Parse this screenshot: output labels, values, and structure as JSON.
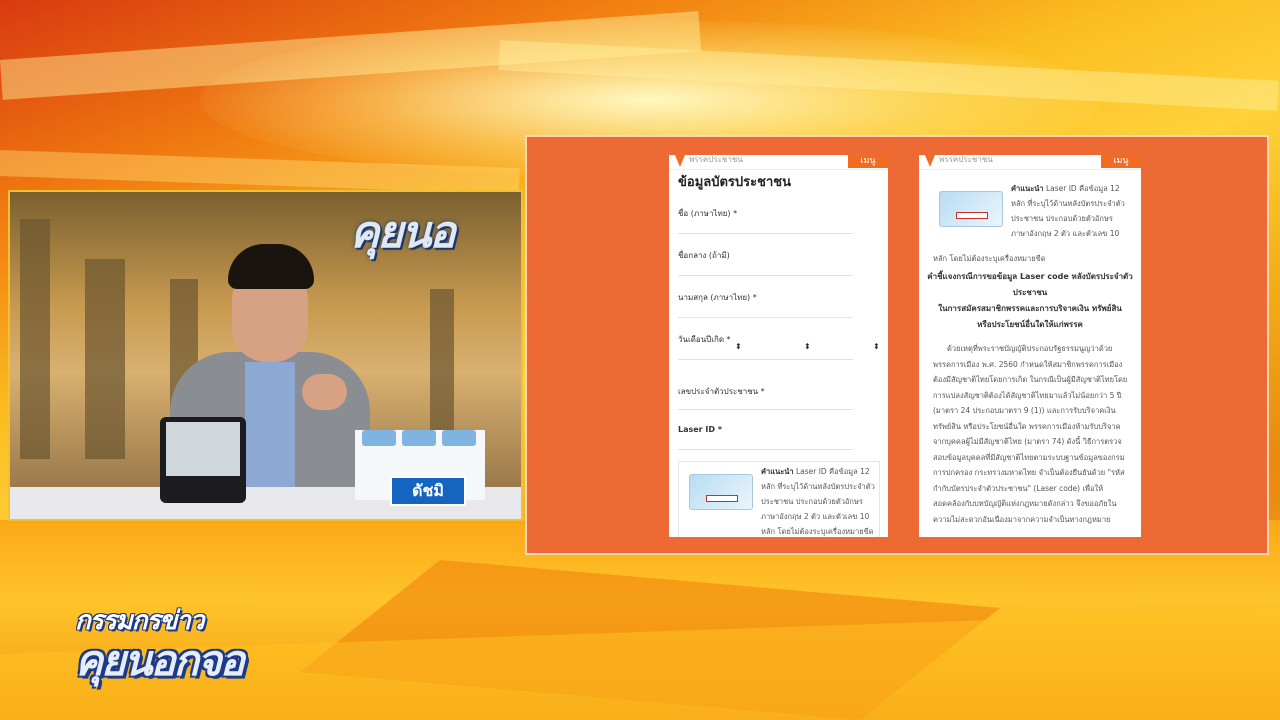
{
  "video": {
    "show_logo": "คุยนอ",
    "sponsor": "ดัชมิ"
  },
  "panel": {
    "left_phone": {
      "header_brand": "พรรคประชาชน",
      "menu_label": "เมนู",
      "form_title": "ข้อมูลบัตรประชาชน",
      "fields": [
        {
          "label": "ชื่อ (ภาษาไทย) *"
        },
        {
          "label": "ชื่อกลาง (ถ้ามี)"
        },
        {
          "label": "นามสกุล (ภาษาไทย) *"
        },
        {
          "label": "วันเดือนปีเกิด *"
        },
        {
          "label": "เลขประจำตัวประชาชน *"
        },
        {
          "label": "Laser ID *"
        }
      ],
      "tip_title": "คำแนะนำ",
      "tip_lines": [
        "Laser ID คือข้อมูล 12",
        "หลัก ที่ระบุไว้ด้านหลังบัตรประจำตัว",
        "ประชาชน ประกอบด้วยตัวอักษร",
        "ภาษาอังกฤษ 2 ตัว และตัวเลข 10",
        "หลัก โดยไม่ต้องระบุเครื่องหมายขีด"
      ]
    },
    "right_phone": {
      "header_brand": "พรรคประชาชน",
      "menu_label": "เมนู",
      "tip_title": "คำแนะนำ",
      "tip_lines": [
        "Laser ID คือข้อมูล 12",
        "หลัก ที่ระบุไว้ด้านหลังบัตรประจำตัว",
        "ประชาชน ประกอบด้วยตัวอักษร",
        "ภาษาอังกฤษ 2 ตัว และตัวเลข 10"
      ],
      "tip_last": "หลัก โดยไม่ต้องระบุเครื่องหมายขีด",
      "heading_lines": [
        "คำชี้แจงกรณีการขอข้อมูล Laser code หลังบัตรประจำตัว",
        "ประชาชน",
        "ในการสมัครสมาชิกพรรคและการบริจาคเงิน ทรัพย์สิน",
        "หรือประโยชน์อื่นใดให้แก่พรรค"
      ],
      "body_lines": [
        "ด้วยเหตุที่พระราชบัญญัติประกอบรัฐธรรมนูญว่าด้วย",
        "พรรคการเมือง พ.ศ. 2560 กำหนดให้สมาชิกพรรคการเมือง",
        "ต้องมีสัญชาติไทยโดยการเกิด ในกรณีเป็นผู้มีสัญชาติไทยโดย",
        "การแปลงสัญชาติต้องได้สัญชาติไทยมาแล้วไม่น้อยกว่า 5 ปี",
        "(มาตรา 24 ประกอบมาตรา 9 (1)) และการรับบริจาคเงิน",
        "ทรัพย์สิน หรือประโยชน์อื่นใด พรรคการเมืองห้ามรับบริจาค",
        "จากบุคคลผู้ไม่มีสัญชาติไทย (มาตรา 74) ดังนี้ วิธีการตรวจ",
        "สอบข้อมูลบุคคลที่มีสัญชาติไทยตามระบบฐานข้อมูลของกรม",
        "การปกครอง กระทรวงมหาดไทย จำเป็นต้องยืนยันด้วย \"รหัส",
        "กำกับบัตรประจำตัวประชาชน\" (Laser code) เพื่อให้",
        "สอดคล้องกับบทบัญญัติแห่งกฎหมายดังกล่าว จึงขออภัยใน",
        "ความไม่สะดวกอันเนื่องมาจากความจำเป็นทางกฎหมาย"
      ]
    }
  },
  "lower_third": {
    "line1": "กรรมกรข่าว",
    "line2": "คุยนอกจอ"
  }
}
